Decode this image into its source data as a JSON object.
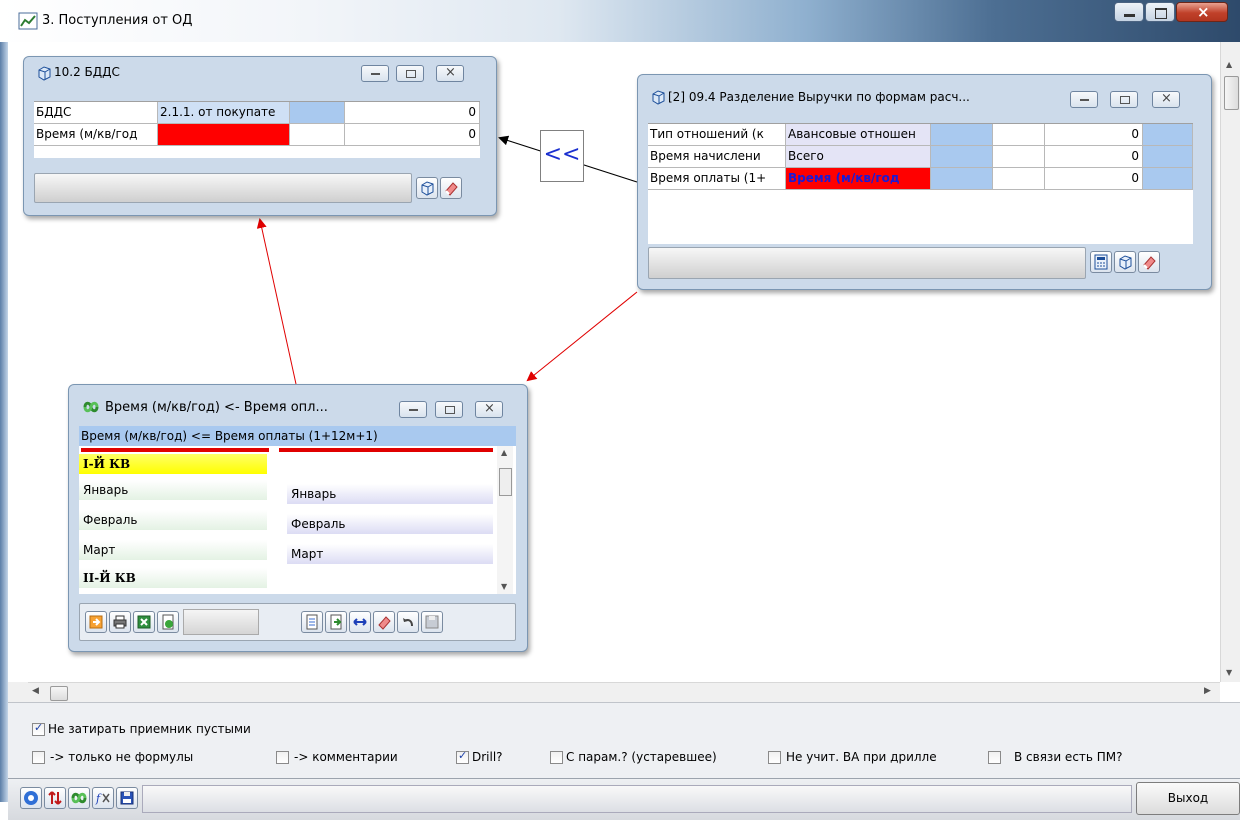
{
  "window": {
    "title": "3. Поступления от ОД"
  },
  "bdds": {
    "title": "10.2 БДДС",
    "rows": [
      {
        "label": "БДДС",
        "value": "2.1.1. от покупате",
        "total": "0"
      },
      {
        "label": "Время (м/кв/год",
        "value": "",
        "total": "0"
      }
    ]
  },
  "revenue": {
    "title": "[2] 09.4 Разделение Выручки по формам расч...",
    "rows": [
      {
        "label": "Тип отношений (к",
        "value": "Авансовые отношен",
        "total": "0"
      },
      {
        "label": "Время начислени",
        "value": "Всего",
        "total": "0"
      },
      {
        "label": "Время оплаты (1+",
        "value": "Время (м/кв/год",
        "total": "0"
      }
    ]
  },
  "link_button": {
    "label": "<<"
  },
  "mapping": {
    "title": "Время (м/кв/год) <- Время опл...",
    "header": "Время (м/кв/год) <= Время оплаты (1+12м+1)",
    "rows": [
      {
        "left": "I-Й КВ",
        "right": ""
      },
      {
        "left": "Январь",
        "right": "Январь"
      },
      {
        "left": "Февраль",
        "right": "Февраль"
      },
      {
        "left": "Март",
        "right": "Март"
      },
      {
        "left": "II-Й КВ",
        "right": ""
      }
    ]
  },
  "options": {
    "no_overwrite": {
      "label": "Не затирать приемник пустыми",
      "checked": true
    },
    "items": [
      {
        "label": "-> только не формулы",
        "checked": false
      },
      {
        "label": "-> комментарии",
        "checked": false
      },
      {
        "label": "Drill?",
        "checked": true
      },
      {
        "label": "С парам.? (устаревшее)",
        "checked": false
      },
      {
        "label": "Не учит. ВА при дрилле",
        "checked": false
      },
      {
        "label": "В связи есть ПМ?",
        "checked": false
      }
    ]
  },
  "footer": {
    "exit_label": "Выход"
  },
  "colors": {
    "red": "#ff0000",
    "blue_cell": "#a9c9ef",
    "yellow": "#ffff33"
  }
}
